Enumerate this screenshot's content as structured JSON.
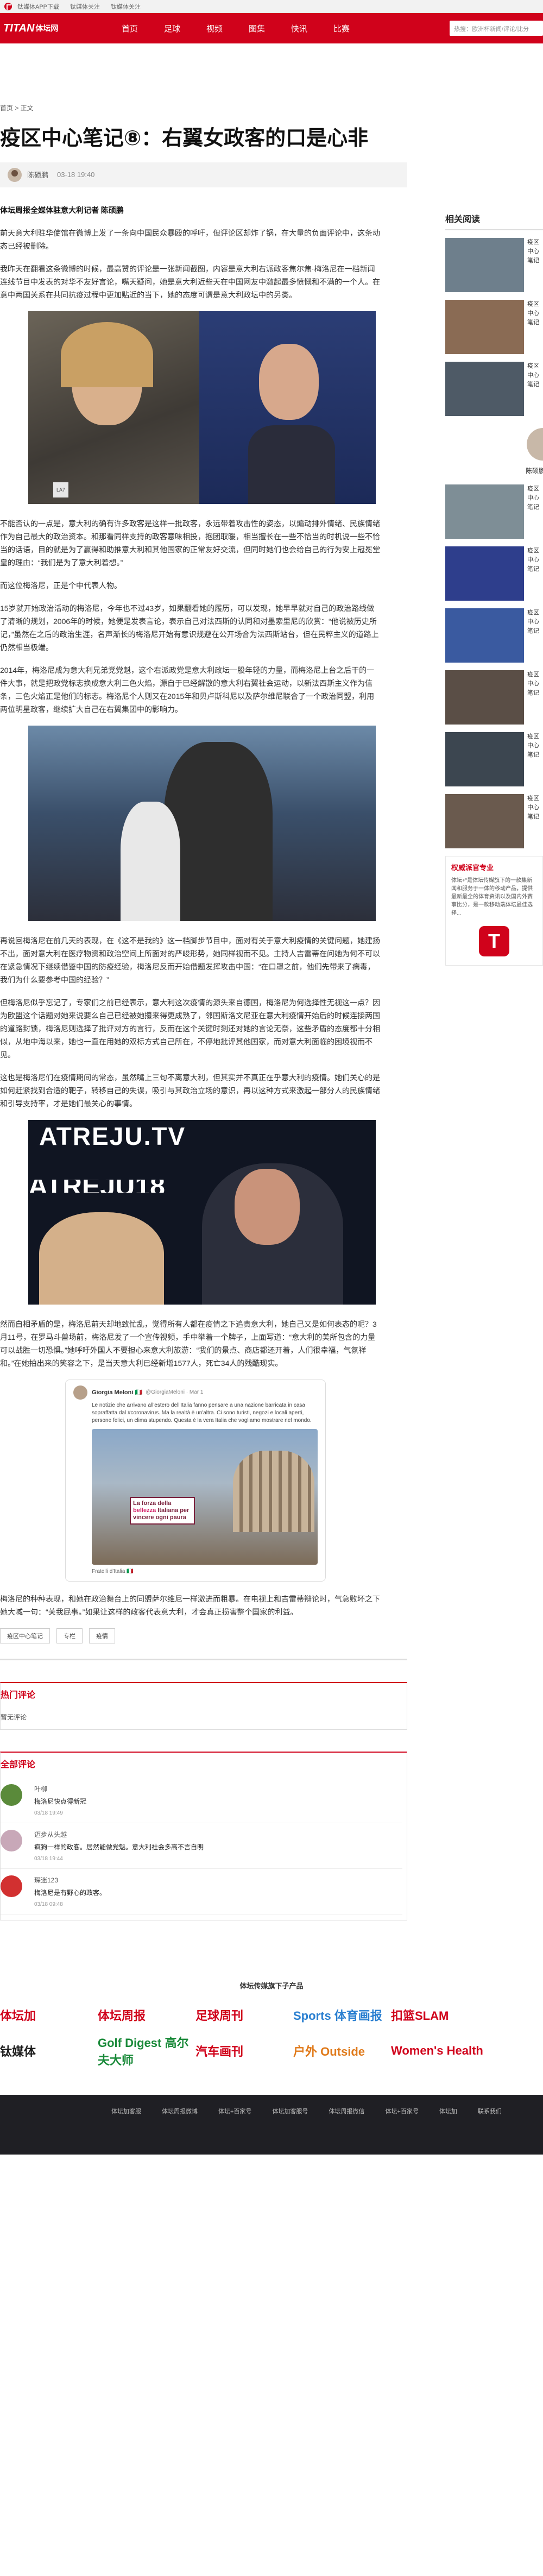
{
  "topbar": {
    "items": [
      "钛媒体APP下载",
      "钛媒体关注",
      "钛媒体关注"
    ]
  },
  "nav": {
    "brand_main": "TITAN",
    "brand_sub": "体坛网",
    "links": [
      "首页",
      "足球",
      "视频",
      "图集",
      "快讯",
      "比赛"
    ],
    "search_placeholder": "热搜：欧洲杯新闻/评论/比分"
  },
  "breadcrumb": "首页 > 正文",
  "article": {
    "title": "疫区中心笔记⑧：右翼女政客的口是心非",
    "author": "陈硕鹏",
    "time": "03-18 19:40",
    "lead": "体坛周报全媒体驻意大利记者 陈硕鹏",
    "paragraphs": [
      "前天意大利驻华使馆在微博上发了一条向中国民众暴殴的呼吁，但评论区却炸了锅，在大量的负面评论中，这条动态已经被删除。",
      "我昨天在翻看这条微博的时候，最高赞的评论是一张新闻截图，内容是意大利右派政客焦尔焦·梅洛尼在一档新闻连线节目中发表的对华不友好言论，嘴天疑问，她是意大利近些天在中国网友中激起最多愤慨和不满的一个人。在意中两国关系在共同抗疫过程中更加贴近的当下，她的态度可谓是意大利政坛中的另类。",
      "不能否认的一点是，意大利的确有许多政客是这样一批政客，永远带着攻击性的姿态，以煽动排外情绪、民族情绪作为自己最大的政治资本。和那看同样支持的政客意味相投，抱团取暖，相当擅长在一些不恰当的时机说一些不恰当的话语，目的就是为了赢得和助推意大利和其他国家的正常友好交流，但同时她们也会给自己的行为安上冠冕堂皇的理由：“我们是为了意大利着想。”",
      "而这位梅洛尼，正是个中代表人物。",
      "15岁就开始政治活动的梅洛尼，今年也不过43岁，如果翻看她的履历，可以发现，她早早就对自己的政治路线做了清晰的规划，2006年的时候，她便是发表言论，表示自己对法西斯的认同和对墨索里尼的欣赏：“他说被历史所记，”虽然在之后的政治生涯，名声渐长的梅洛尼开始有意识规避在公开场合为法西斯站台，但在民粹主义的道路上仍然相当极端。",
      "2014年，梅洛尼成为意大利兄弟党党魁，这个右派政党是意大利政坛一股年轻的力量，而梅洛尼上台之后干的一件大事，就是把政党标志换成意大利三色火焰，源自于已经解散的意大利右翼社会运动，以新法西斯主义作为信条，三色火焰正是他们的标志。梅洛尼个人则又在2015年和贝卢斯科尼以及萨尔维尼联合了一个政治同盟，利用两位明星政客，继续扩大自己在右翼集团中的影响力。",
      "再说回梅洛尼在前几天的表现，在《这不是我的》这一档脚步节目中，面对有关于意大利疫情的关键问题，她建扬不出，面对意大利在医疗物资和政治空间上所面对的严峻形势，她同样视而不见。主持人吉雷蒂在问她为何不可以在紧急情况下继续借鉴中国的防疫经验，梅洛尼反而开始借题发挥攻击中国：“在口罩之前，他们先带来了病毒，我们为什么要参考中国的经验？”",
      "但梅洛尼似乎忘记了，专家们之前已经表示，意大利这次疫情的源头来自德国，梅洛尼为何选择性无视这一点？因为欧盟这个话题对她来说要么自己已经被她攥来得更成熟了，邻国斯洛文尼亚在意大利疫情开始后的时候连接两国的道路封锁，梅洛尼则选择了批评对方的言行，反而在这个关键时刻还对她的言论无奈，这些矛盾的态度都十分相似，从地中海以来，她也一直在用她的双标方式自己所在，不停地批评其他国家，而对意大利面临的困境视而不见。",
      "这也是梅洛尼们在疫情期间的常态，虽然嘴上三句不离意大利，但其实并不真正在乎意大利的疫情。她们关心的是如何赶紧找到合适的靶子，转移自己的失误，吸引与其政治立场的意识，再以这种方式来激起一部分人的民族情绪和引导支持率，才是她们最关心的事情。",
      "然而自相矛盾的是，梅洛尼前天却地致忙乱，觉得所有人都在疫情之下追责意大利，她自己又是如何表态的呢？3月11号，在罗马斗兽场前，梅洛尼发了一个宣传视频，手中举着一个牌子，上面写道：“意大利的美所包含的力量可以战胜一切恐惧。”她呼吁外国人不要担心来意大利旅游：“我们的景点、商店都还开着，人们很幸福，气氛祥和。”在她拍出来的笑容之下，是当天意大利已经新增1577人，死亡34人的残酷现实。",
      "梅洛尼的种种表现，和她在政治舞台上的同盟萨尔维尼一样激进而粗暴。在电视上和吉雷蒂辩论时，气急败坏之下她大喊一句：“关我屁事。”如果让这样的政客代表意大利，才会真正损害整个国家的利益。"
    ],
    "photo1_caption": "LA7",
    "photo3_banner_top": "ATREJU.TV",
    "photo3_banner_mid": "ATREJU18",
    "tweet": {
      "name": "Giorgia Meloni 🇮🇹",
      "handle": "@GiorgiaMeloni · Mar 1",
      "text": "Le notizie che arrivano all'estero dell'Italia fanno pensare a una nazione barricata in casa sopraffatta dal #coronavirus. Ma la realtà è un'altra. Ci sono turisti, negozi e locali aperti, persone felici, un clima stupendo. Questa è la vera Italia che vogliamo mostrare nel mondo.",
      "sign_line1": "La forza della",
      "sign_pink": "bellezza",
      "sign_line2": "Italiana per vincere ogni paura",
      "footer": "Fratelli d'Italia 🇮🇹"
    },
    "tags": [
      "疫区中心笔记",
      "专栏",
      "疫情"
    ]
  },
  "sidebar": {
    "related_title": "相关阅读",
    "related": [
      "疫区中心笔记",
      "疫区中心笔记",
      "疫区中心笔记"
    ],
    "author_name": "陈硕鹏",
    "more": [
      "疫区中心笔记",
      "疫区中心笔记",
      "疫区中心笔记",
      "疫区中心笔记",
      "疫区中心笔记",
      "疫区中心笔记"
    ],
    "ad_title": "权威派官专业",
    "ad_text": "体坛+“是体坛传媒旗下的一款集新闻和服务于一体的移动产品，提供最新最全的体育资讯以及国内外赛事比分，是一款移动端体坛最佳选择..."
  },
  "comments": {
    "hot_title": "热门评论",
    "hot_empty": "暂无评论",
    "all_title": "全部评论",
    "items": [
      {
        "name": "叶柳",
        "text": "梅洛尼快点得新冠",
        "time": "03/18 19:49",
        "color": "#5a8a3a"
      },
      {
        "name": "迈步从头越",
        "text": "疯狗一样的政客。居然能做党魁。意大利社会多高不言自明",
        "time": "03/18 19:44",
        "color": "#c8a8b8"
      },
      {
        "name": "琛迷123",
        "text": "梅洛尼是有野心的政客。",
        "time": "03/18 09:48",
        "color": "#d23030"
      }
    ]
  },
  "footer": {
    "title": "体坛传媒旗下子产品",
    "brands": [
      {
        "name": "体坛加",
        "color": "#d0021b"
      },
      {
        "name": "体坛周报",
        "color": "#d0021b"
      },
      {
        "name": "足球周刊",
        "color": "#d0021b"
      },
      {
        "name": "Sports 体育画报",
        "color": "#2a7fd0"
      },
      {
        "name": "扣篮SLAM",
        "color": "#d0021b"
      },
      {
        "name": "钛媒体",
        "color": "#1a1a1a"
      },
      {
        "name": "Golf Digest 高尔夫大师",
        "color": "#1a8a3a"
      },
      {
        "name": "汽车画刊",
        "color": "#d0021b"
      },
      {
        "name": "户外 Outside",
        "color": "#e07a1a"
      },
      {
        "name": "Women's Health",
        "color": "#d0021b"
      }
    ],
    "links": [
      "体坛加客服",
      "体坛周报微博",
      "体坛+百家号",
      "体坛加客服号",
      "体坛周报微信",
      "体坛+百家号",
      "体坛加",
      "联系我们"
    ]
  }
}
